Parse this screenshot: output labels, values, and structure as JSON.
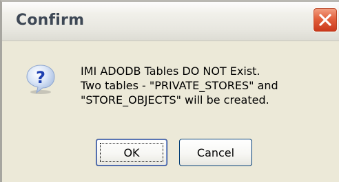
{
  "dialog": {
    "title": "Confirm",
    "icon": "question-icon",
    "message_lines": [
      "IMI ADODB Tables DO NOT Exist.",
      "Two tables - \"PRIVATE_STORES\" and",
      "\"STORE_OBJECTS\" will be created."
    ],
    "buttons": {
      "ok_label": "OK",
      "cancel_label": "Cancel"
    }
  },
  "colors": {
    "window_face": "#ece9d8",
    "close_button": "#e2613d",
    "button_border": "#1f3c80"
  }
}
